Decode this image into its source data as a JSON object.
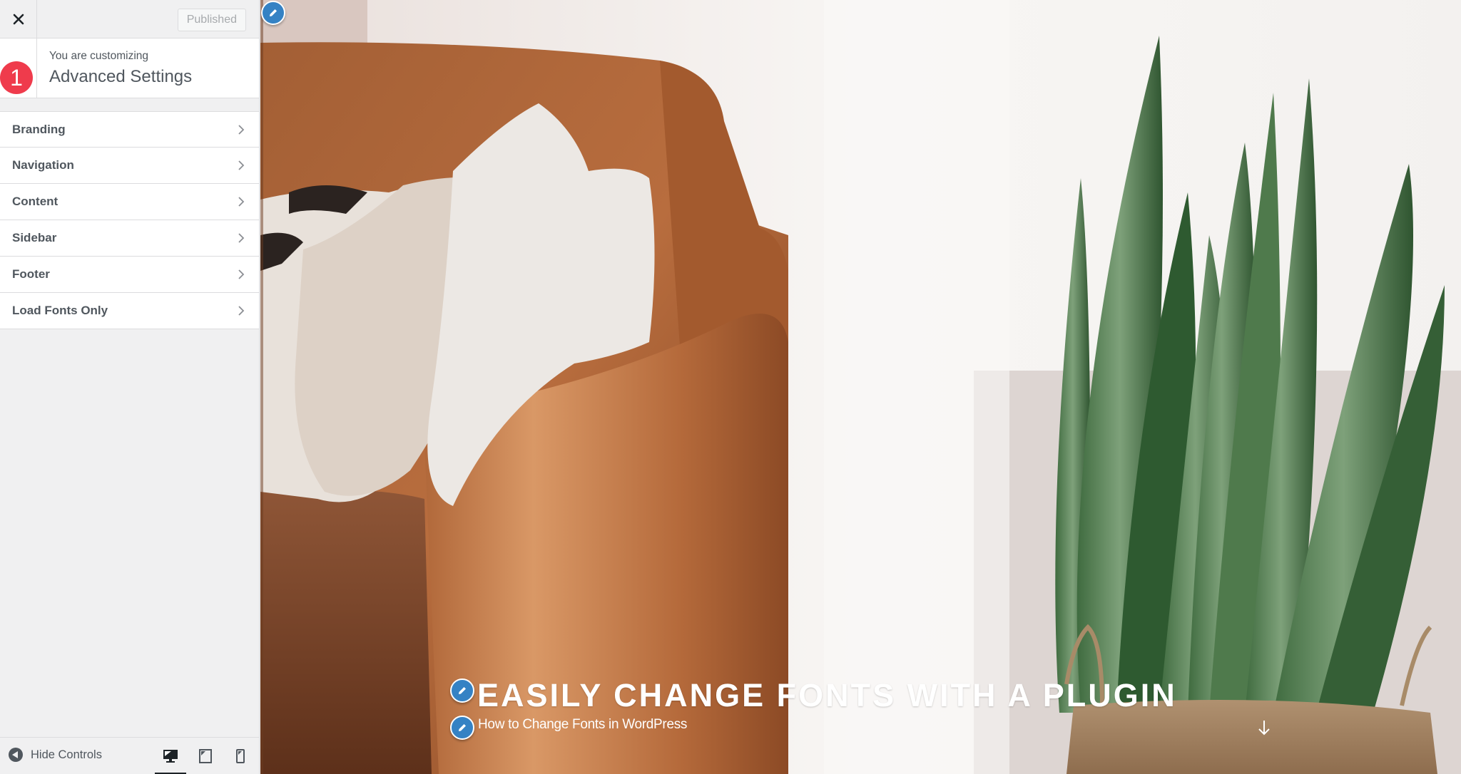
{
  "header": {
    "close_icon": "close-icon",
    "publish_label": "Published"
  },
  "info": {
    "pre_title": "You are customizing",
    "title": "Advanced Settings",
    "step_badge": "1",
    "badge_color": "#ef3b4c"
  },
  "sections": [
    {
      "label": "Branding"
    },
    {
      "label": "Navigation"
    },
    {
      "label": "Content"
    },
    {
      "label": "Sidebar"
    },
    {
      "label": "Footer"
    },
    {
      "label": "Load Fonts Only"
    }
  ],
  "footer": {
    "hide_controls_label": "Hide Controls",
    "devices": [
      {
        "name": "desktop",
        "icon": "desktop-icon",
        "active": true
      },
      {
        "name": "tablet",
        "icon": "tablet-icon",
        "active": false
      },
      {
        "name": "mobile",
        "icon": "mobile-icon",
        "active": false
      }
    ]
  },
  "preview": {
    "hero_title": "EASILY CHANGE FONTS WITH A PLUGIN",
    "hero_subtitle": "How to Change Fonts in WordPress",
    "edit_shortcut_color": "#3582c4",
    "scroll_icon": "arrow-down-icon"
  }
}
